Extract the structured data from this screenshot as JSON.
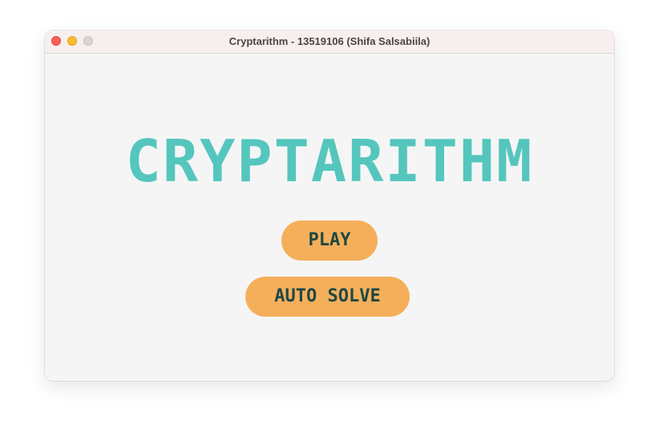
{
  "window": {
    "title": "Cryptarithm - 13519106 (Shifa Salsabiila)"
  },
  "main": {
    "logo_text": "CRYPTARITHM",
    "play_label": "PLAY",
    "auto_solve_label": "AUTO SOLVE"
  },
  "colors": {
    "logo": "#55c6bd",
    "button_bg": "#f5af5b",
    "button_text": "#1f4844",
    "window_bg": "#f5f5f5"
  }
}
